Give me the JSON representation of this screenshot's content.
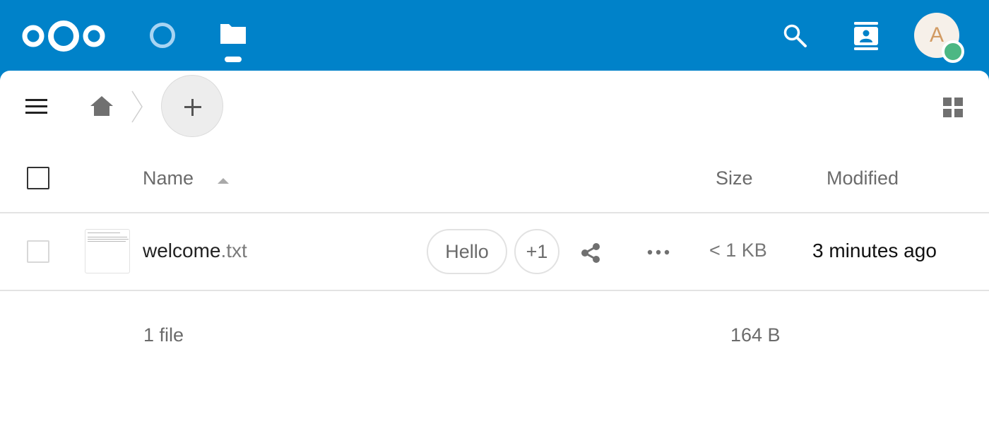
{
  "header": {
    "logo_icon": "nextcloud-logo-icon",
    "apps": [
      {
        "name": "dashboard",
        "icon": "circle-icon"
      },
      {
        "name": "files",
        "icon": "folder-icon",
        "active": true
      }
    ],
    "search_icon": "search-icon",
    "contacts_icon": "contacts-icon",
    "avatar_initial": "A",
    "status": "online",
    "colors": {
      "brand": "#0082c9",
      "status_online": "#4cb784",
      "avatar_bg": "#f6f0e9",
      "avatar_text": "#d29b63"
    }
  },
  "toolbar": {
    "menu_icon": "hamburger-menu-icon",
    "home_icon": "home-icon",
    "new_button_icon": "plus-icon",
    "view_toggle_icon": "grid-view-icon"
  },
  "table": {
    "columns": {
      "name": "Name",
      "size": "Size",
      "modified": "Modified"
    },
    "sort": {
      "column": "name",
      "direction": "ascending"
    },
    "rows": [
      {
        "name_base": "welcome",
        "name_ext": ".txt",
        "tags": [
          "Hello",
          "+1"
        ],
        "size": "< 1 KB",
        "modified": "3 minutes ago",
        "selected": false
      }
    ],
    "summary": {
      "count": "1 file",
      "total_size": "164 B"
    }
  }
}
